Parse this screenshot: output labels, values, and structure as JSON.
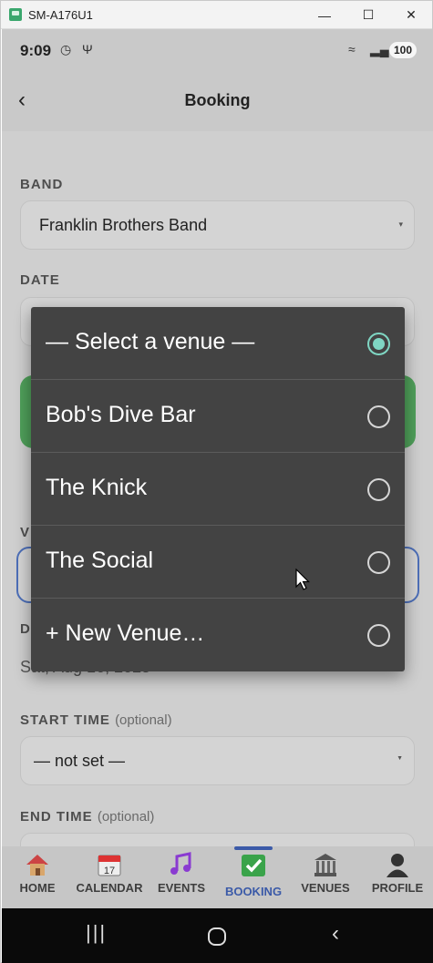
{
  "window": {
    "title": "SM-A176U1",
    "controls": [
      "minimize",
      "maximize",
      "close"
    ]
  },
  "status": {
    "time": "9:09",
    "battery": "100"
  },
  "appbar": {
    "title": "Booking",
    "back_glyph": "‹"
  },
  "form": {
    "band": {
      "label": "BAND",
      "value": "Franklin Brothers Band"
    },
    "date": {
      "label": "DATE"
    },
    "venue_label_first": "V",
    "date2": {
      "label_first": "D",
      "value": "Sat, Aug 16, 2025"
    },
    "start_time": {
      "label": "START TIME",
      "optional": "(optional)",
      "value": "— not set —"
    },
    "end_time": {
      "label": "END TIME",
      "optional": "(optional)"
    }
  },
  "dropdown": {
    "options": [
      {
        "label": "— Select a venue —",
        "selected": true
      },
      {
        "label": "Bob's Dive Bar",
        "selected": false
      },
      {
        "label": "The Knick",
        "selected": false
      },
      {
        "label": "The Social",
        "selected": false
      },
      {
        "label": "+ New Venue…",
        "selected": false
      }
    ]
  },
  "nav": {
    "items": [
      {
        "label": "HOME",
        "icon": "house-icon"
      },
      {
        "label": "CALENDAR",
        "icon": "calendar-icon"
      },
      {
        "label": "EVENTS",
        "icon": "music-note-icon"
      },
      {
        "label": "BOOKING",
        "icon": "checkmark-icon"
      },
      {
        "label": "VENUES",
        "icon": "building-icon"
      },
      {
        "label": "PROFILE",
        "icon": "person-icon"
      }
    ],
    "active": "BOOKING"
  },
  "colors": {
    "accent": "#3b5aa8",
    "radio_selected": "#7fd6c3",
    "dropdown_bg": "#434343",
    "green_button": "#4f9f5a"
  }
}
